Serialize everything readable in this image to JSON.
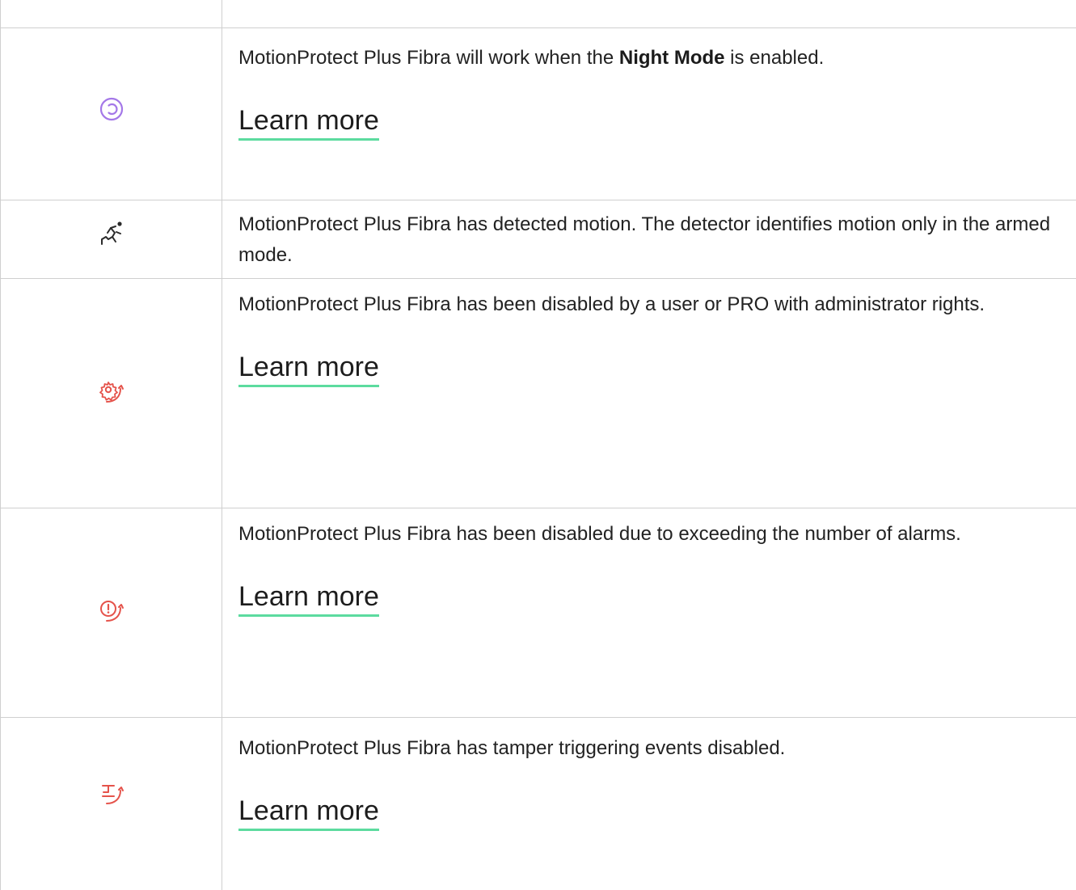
{
  "rows": [
    {
      "icon": "empty",
      "description": ""
    },
    {
      "icon": "night-mode-icon",
      "icon_color": "#a478e8",
      "description_parts": [
        "MotionProtect Plus Fibra will work when the ",
        "Night Mode",
        " is enabled."
      ],
      "link_label": "Learn more"
    },
    {
      "icon": "motion-detected-icon",
      "icon_color": "#2b2b2b",
      "description": "MotionProtect Plus Fibra has detected motion. The detector identifies motion only in the armed mode."
    },
    {
      "icon": "disabled-by-user-icon",
      "icon_color": "#e5534b",
      "description": "MotionProtect Plus Fibra has been disabled by a user or PRO with administrator rights.",
      "link_label": "Learn more"
    },
    {
      "icon": "disabled-by-alarms-icon",
      "icon_color": "#e5534b",
      "description": "MotionProtect Plus Fibra has been disabled due to exceeding the number of alarms.",
      "link_label": "Learn more"
    },
    {
      "icon": "tamper-disabled-icon",
      "icon_color": "#e5534b",
      "description": "MotionProtect Plus Fibra has tamper triggering events disabled.",
      "link_label": "Learn more"
    }
  ],
  "colors": {
    "border": "#cfcfcf",
    "link_underline": "#5cdb9f",
    "text": "#222222"
  }
}
